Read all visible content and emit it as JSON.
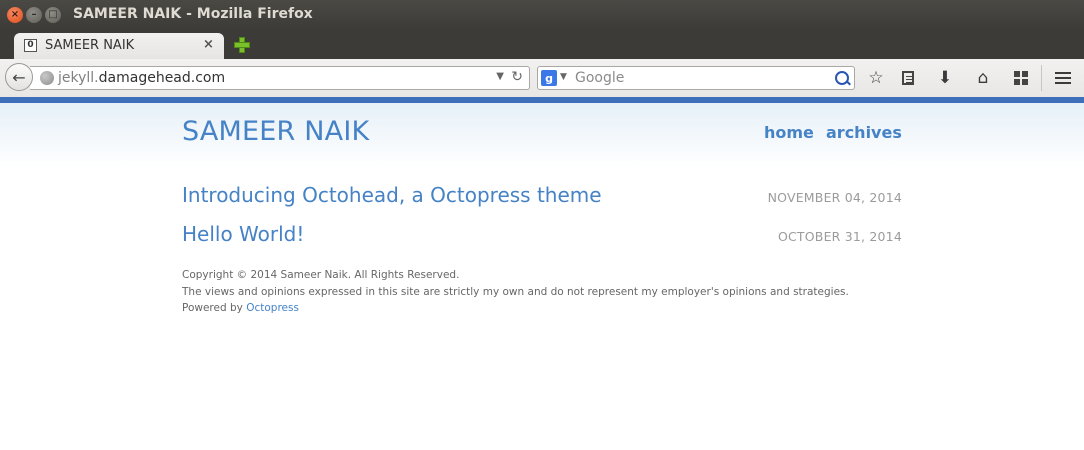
{
  "window": {
    "title": "SAMEER NAIK - Mozilla Firefox"
  },
  "tabs": [
    {
      "title": "SAMEER NAIK",
      "favicon_glyph": "0",
      "active": true
    }
  ],
  "navbar": {
    "url_subdomain": "jekyll.",
    "url_domain": "damagehead.com",
    "search_placeholder": "Google",
    "search_engine_glyph": "g",
    "icons": [
      "back-icon",
      "globe-icon",
      "reload-icon",
      "search-engine-icon",
      "magnifier-icon",
      "bookmark-star-icon",
      "reading-list-icon",
      "downloads-icon",
      "home-icon",
      "apps-grid-icon",
      "menu-icon"
    ]
  },
  "site": {
    "title": "SAMEER NAIK",
    "nav": [
      {
        "label": "home"
      },
      {
        "label": "archives"
      }
    ],
    "posts": [
      {
        "title": "Introducing Octohead, a Octopress theme",
        "date": "NOVEMBER 04, 2014"
      },
      {
        "title": "Hello World!",
        "date": "OCTOBER 31, 2014"
      }
    ],
    "footer": {
      "copyright": "Copyright © 2014 Sameer Naik. All Rights Reserved.",
      "disclaimer": "The views and opinions expressed in this site are strictly my own and do not represent my employer's opinions and strategies.",
      "powered_prefix": "Powered by ",
      "powered_link": "Octopress"
    }
  },
  "colors": {
    "link": "#4582c6",
    "accent_bar": "#3d6fba",
    "date": "#9b9b9b"
  }
}
